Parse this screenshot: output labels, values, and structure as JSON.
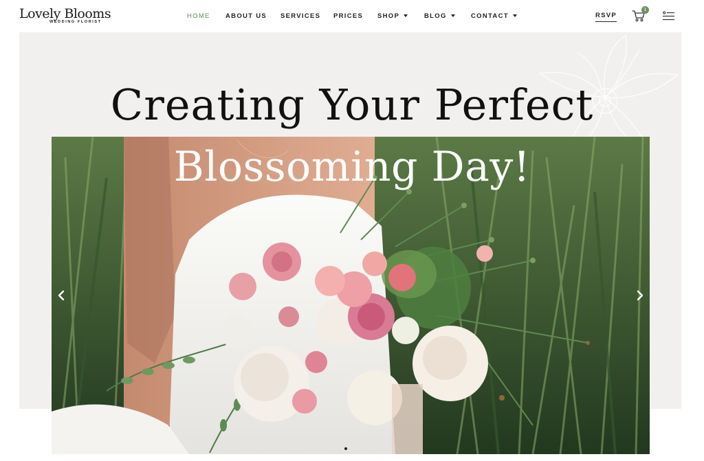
{
  "brand": {
    "name": "Lovely Blooms",
    "tagline": "WEDDING FLORIST"
  },
  "nav": {
    "items": [
      {
        "label": "HOME",
        "active": true,
        "dropdown": false
      },
      {
        "label": "ABOUT US",
        "active": false,
        "dropdown": false
      },
      {
        "label": "SERVICES",
        "active": false,
        "dropdown": false
      },
      {
        "label": "PRICES",
        "active": false,
        "dropdown": false
      },
      {
        "label": "SHOP",
        "active": false,
        "dropdown": true
      },
      {
        "label": "BLOG",
        "active": false,
        "dropdown": true
      },
      {
        "label": "CONTACT",
        "active": false,
        "dropdown": true
      }
    ],
    "rsvp_label": "RSVP",
    "cart_count": "1"
  },
  "hero": {
    "headline": "Creating Your Perfect",
    "subheadline": "Blossoming Day!",
    "slide_count": 1,
    "current_slide": 1
  },
  "icons": {
    "cart": "cart-icon",
    "menu": "menu-icon",
    "prev": "chevron-left-icon",
    "next": "chevron-right-icon"
  },
  "colors": {
    "accent": "#5f8d5a",
    "hero_background": "#f2f0ee",
    "badge": "#6f8f62"
  }
}
